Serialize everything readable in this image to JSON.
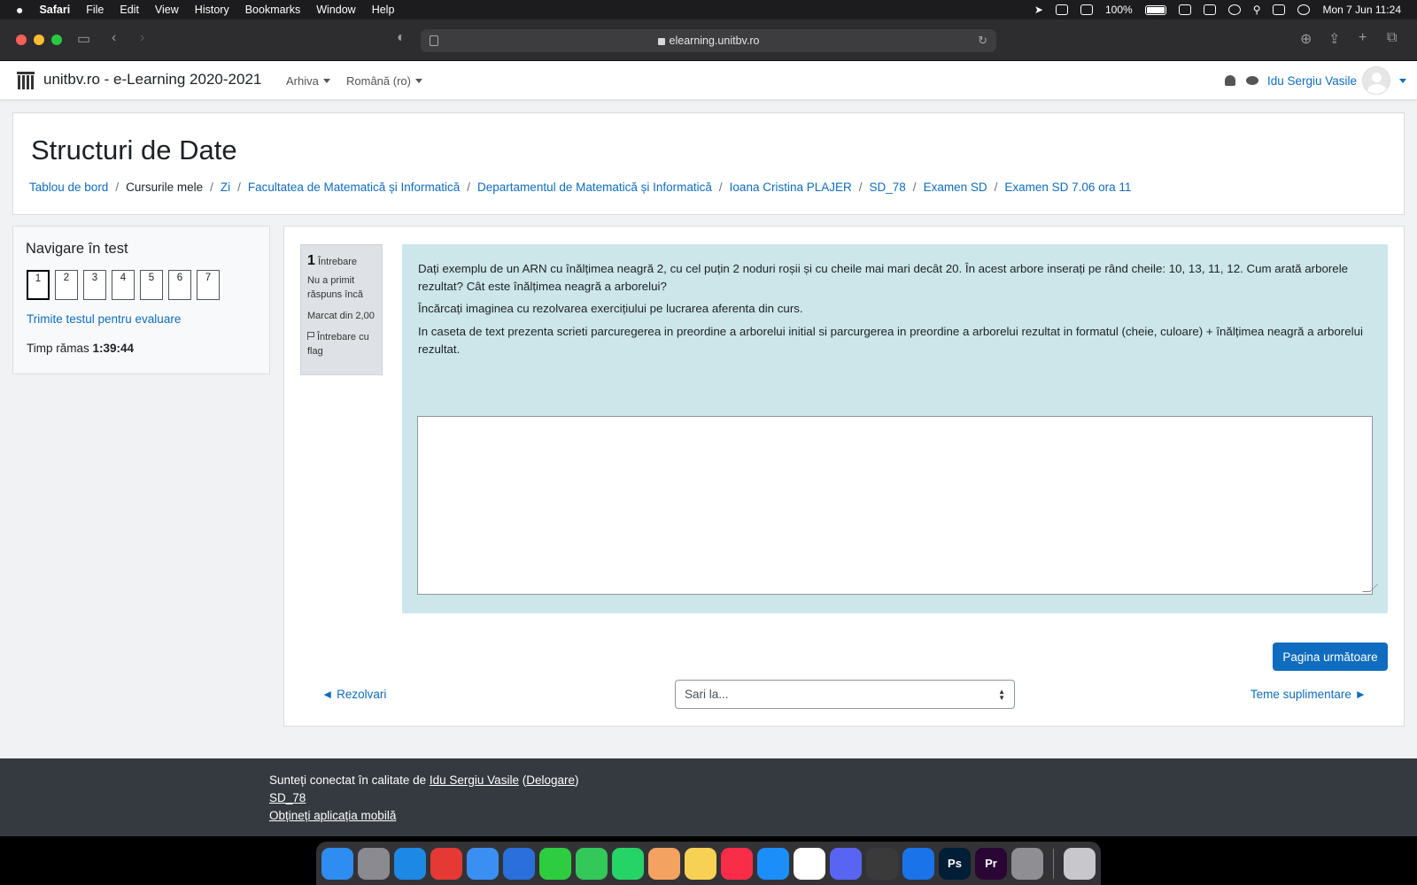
{
  "menubar": {
    "app": "Safari",
    "items": [
      "File",
      "Edit",
      "View",
      "History",
      "Bookmarks",
      "Window",
      "Help"
    ],
    "battery": "100%",
    "clock": "Mon 7 Jun  11:24"
  },
  "browser": {
    "url": "elearning.unitbv.ro"
  },
  "navbar": {
    "site_title": "unitbv.ro - e-Learning 2020-2021",
    "archive_menu": "Arhiva",
    "language_menu": "Română (ro)",
    "user_name": "Idu Sergiu Vasile"
  },
  "header": {
    "title": "Structuri de Date",
    "breadcrumb": [
      "Tablou de bord",
      "Cursurile mele",
      "Zi",
      "Facultatea de Matematică și Informatică",
      "Departamentul de Matematică și Informatică",
      "Ioana Cristina PLAJER",
      "SD_78",
      "Examen SD",
      "Examen SD 7.06 ora 11"
    ]
  },
  "quiz_nav": {
    "title": "Navigare în test",
    "questions": [
      "1",
      "2",
      "3",
      "4",
      "5",
      "6",
      "7"
    ],
    "finish_link": "Trimite testul pentru evaluare",
    "time_label": "Timp rămas",
    "time_value": "1:39:44"
  },
  "question": {
    "number": "1",
    "word": "Întrebare",
    "state": "Nu a primit răspuns încă",
    "grade": "Marcat din 2,00",
    "flag": "Întrebare cu flag",
    "text_1": "Dați exemplu de un ARN cu înălțimea neagră 2, cu cel puțin 2 noduri roșii și cu cheile mai mari decât 20. În acest arbore inserați pe rând cheile: 10, 13, 11, 12. Cum arată arborele rezultat? Cât este înălțimea neagră a arborelui?",
    "text_2": "Încărcați imaginea cu rezolvarea exercițiului pe lucrarea aferenta din curs.",
    "text_3": "In caseta de text prezenta scrieti parcuregerea in preordine a arborelui initial si parcurgerea in preordine a arborelui rezultat in formatul (cheie, culoare) + înălțimea neagră a arborelui rezultat.",
    "answer_value": ""
  },
  "actions": {
    "next_page": "Pagina următoare",
    "prev_link": "◄ Rezolvari",
    "jump_placeholder": "Sari la...",
    "next_link": "Teme suplimentare ►"
  },
  "footer": {
    "logged_in_prefix": "Sunteți conectat în calitate de",
    "user_name": "Idu Sergiu Vasile",
    "logout": "Delogare",
    "course": "SD_78",
    "mobile_app": "Obțineți aplicația mobilă"
  },
  "dock": {
    "apps": [
      {
        "icon": "finder-icon",
        "color": "#2f8cf0",
        "label": ""
      },
      {
        "icon": "launchpad-icon",
        "color": "#8a8a90",
        "label": ""
      },
      {
        "icon": "safari-icon",
        "color": "#1e88e5",
        "label": ""
      },
      {
        "icon": "chrome-icon",
        "color": "#e53935",
        "label": ""
      },
      {
        "icon": "mail-icon",
        "color": "#3b8ff3",
        "label": ""
      },
      {
        "icon": "navigation-icon",
        "color": "#2a6fdb",
        "label": ""
      },
      {
        "icon": "facetime-icon",
        "color": "#2ecc40",
        "label": ""
      },
      {
        "icon": "messages-icon",
        "color": "#34c759",
        "label": ""
      },
      {
        "icon": "whatsapp-icon",
        "color": "#25d366",
        "label": ""
      },
      {
        "icon": "photos-icon",
        "color": "#f4a261",
        "label": ""
      },
      {
        "icon": "notes-icon",
        "color": "#f7d154",
        "label": ""
      },
      {
        "icon": "music-icon",
        "color": "#fa2d48",
        "label": ""
      },
      {
        "icon": "appstore-icon",
        "color": "#1c8ef9",
        "label": ""
      },
      {
        "icon": "slack-icon",
        "color": "#ffffff",
        "label": ""
      },
      {
        "icon": "discord-icon",
        "color": "#5865f2",
        "label": ""
      },
      {
        "icon": "sublime-icon",
        "color": "#3a3a3a",
        "label": ""
      },
      {
        "icon": "xcode-icon",
        "color": "#1a73e8",
        "label": ""
      },
      {
        "icon": "photoshop-icon",
        "color": "#001e36",
        "label": "Ps"
      },
      {
        "icon": "premiere-icon",
        "color": "#2a0634",
        "label": "Pr"
      },
      {
        "icon": "settings-icon",
        "color": "#8e8e93",
        "label": ""
      }
    ],
    "trash": {
      "icon": "trash-icon",
      "color": "#c7c7cc"
    }
  }
}
